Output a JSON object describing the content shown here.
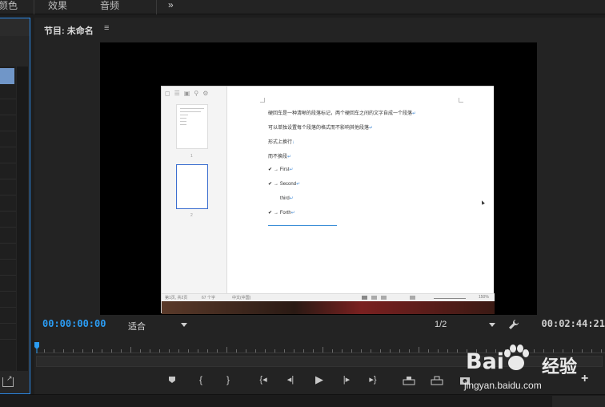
{
  "menu": {
    "tabs": [
      "颜色",
      "效果",
      "音频"
    ],
    "overflow": "»"
  },
  "monitor": {
    "title": "节目: 未命名",
    "menu_icon": "≡",
    "timecode_current": "00:00:00:00",
    "zoom": "适合",
    "resolution": "1/2",
    "timecode_duration": "00:02:44:21"
  },
  "document": {
    "lines": [
      {
        "text": "硬回车是一种清晰的段落标记，两个硬回车之间的文字自成一个段落",
        "mark": "↵"
      },
      {
        "text": "可以单独设置每个段落的格式而不影响其他段落",
        "mark": "↵"
      },
      {
        "text": "形式上换行",
        "mark": "↓"
      },
      {
        "text": "而不换段",
        "mark": "↵"
      }
    ],
    "list": [
      {
        "check": "✔",
        "text": "→ First",
        "mark": "↵"
      },
      {
        "check": "✔",
        "text": "→ Second",
        "mark": "↵"
      },
      {
        "check": "",
        "text": "third",
        "mark": "↵"
      },
      {
        "check": "✔",
        "text": "→ Forth",
        "mark": "↵"
      }
    ],
    "page_numbers": [
      "1",
      "2"
    ],
    "status": {
      "page": "第1页, 共2页",
      "words": "67 个字",
      "lang": "中文(中国)",
      "zoom": "150%"
    }
  },
  "controls": {
    "labels": [
      "marker-icon",
      "in-point-icon",
      "out-point-icon",
      "go-to-in-icon",
      "step-back-icon",
      "play-icon",
      "step-forward-icon",
      "go-to-out-icon",
      "lift-icon",
      "extract-icon",
      "export-frame-icon",
      "add-button-icon"
    ]
  },
  "watermark": {
    "brand_left": "Bai",
    "brand_right": "经验",
    "url": "jingyan.baidu.com"
  },
  "colors": {
    "accent": "#2b9cf3",
    "panel_bg": "#232323",
    "selection": "#7096c8"
  }
}
